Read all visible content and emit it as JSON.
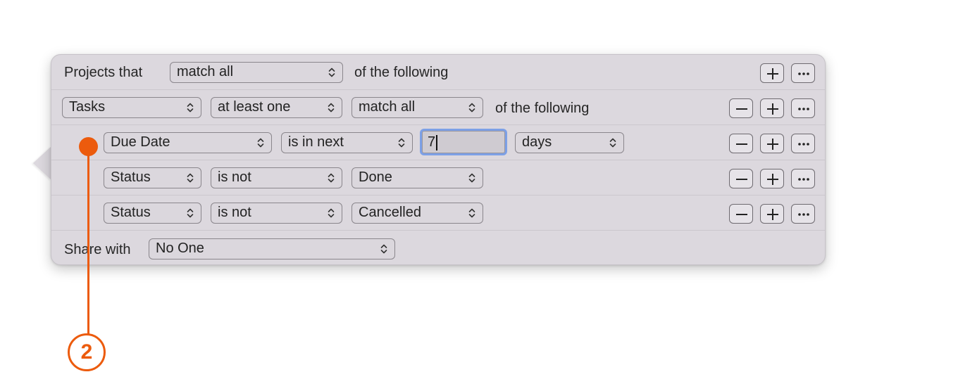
{
  "header": {
    "prefix": "Projects that",
    "match_select": "match all",
    "suffix": "of the following"
  },
  "group_row": {
    "field_select": "Tasks",
    "quantifier_select": "at least one",
    "match_select": "match all",
    "suffix": "of the following"
  },
  "conditions": [
    {
      "field": "Due Date",
      "operator": "is in next",
      "value": "7",
      "unit": "days"
    },
    {
      "field": "Status",
      "operator": "is not",
      "value": "Done"
    },
    {
      "field": "Status",
      "operator": "is not",
      "value": "Cancelled"
    }
  ],
  "share": {
    "label": "Share with",
    "select": "No One"
  },
  "callout": {
    "number": "2",
    "color": "#ec5b0d"
  },
  "buttons": {
    "remove_icon": "minus-icon",
    "add_icon": "plus-icon",
    "more_icon": "ellipsis-icon"
  }
}
